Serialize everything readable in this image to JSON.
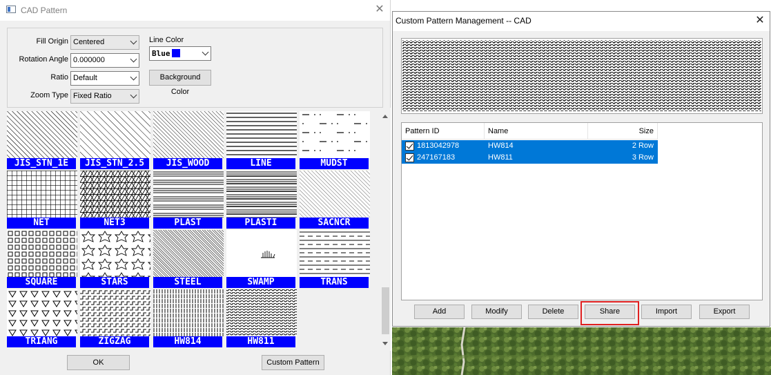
{
  "cad_dialog": {
    "title": "CAD Pattern",
    "fill_origin": {
      "label": "Fill Origin",
      "value": "Centered"
    },
    "rotation_angle": {
      "label": "Rotation Angle",
      "value": "0.000000"
    },
    "ratio": {
      "label": "Ratio",
      "value": "Default"
    },
    "zoom_type": {
      "label": "Zoom Type",
      "value": "Fixed Ratio"
    },
    "line_color": {
      "label": "Line Color",
      "value": "Blue",
      "swatch": "#0000ff"
    },
    "background_color_button": "Background Color",
    "patterns": [
      "JIS_STN_1E",
      "JIS_STN_2.5",
      "JIS_WOOD",
      "LINE",
      "MUDST",
      "NET",
      "NET3",
      "PLAST",
      "PLASTI",
      "SACNCR",
      "SQUARE",
      "STARS",
      "STEEL",
      "SWAMP",
      "TRANS",
      "TRIANG",
      "ZIGZAG",
      "HW814",
      "HW811"
    ],
    "ok_button": "OK",
    "custom_pattern_button": "Custom Pattern"
  },
  "mgmt_dialog": {
    "title": "Custom Pattern Management -- CAD",
    "columns": [
      "Pattern ID",
      "Name",
      "Size"
    ],
    "rows": [
      {
        "id": "1813042978",
        "name": "HW814",
        "size": "2 Row",
        "checked": true
      },
      {
        "id": "247167183",
        "name": "HW811",
        "size": "3 Row",
        "checked": true
      }
    ],
    "buttons": {
      "add": "Add",
      "modify": "Modify",
      "delete": "Delete",
      "share": "Share",
      "import": "Import",
      "export": "Export"
    },
    "highlighted_button": "share"
  },
  "colors": {
    "selection": "#0078d7",
    "label_bg": "#0000ff",
    "highlight": "#e02020"
  }
}
